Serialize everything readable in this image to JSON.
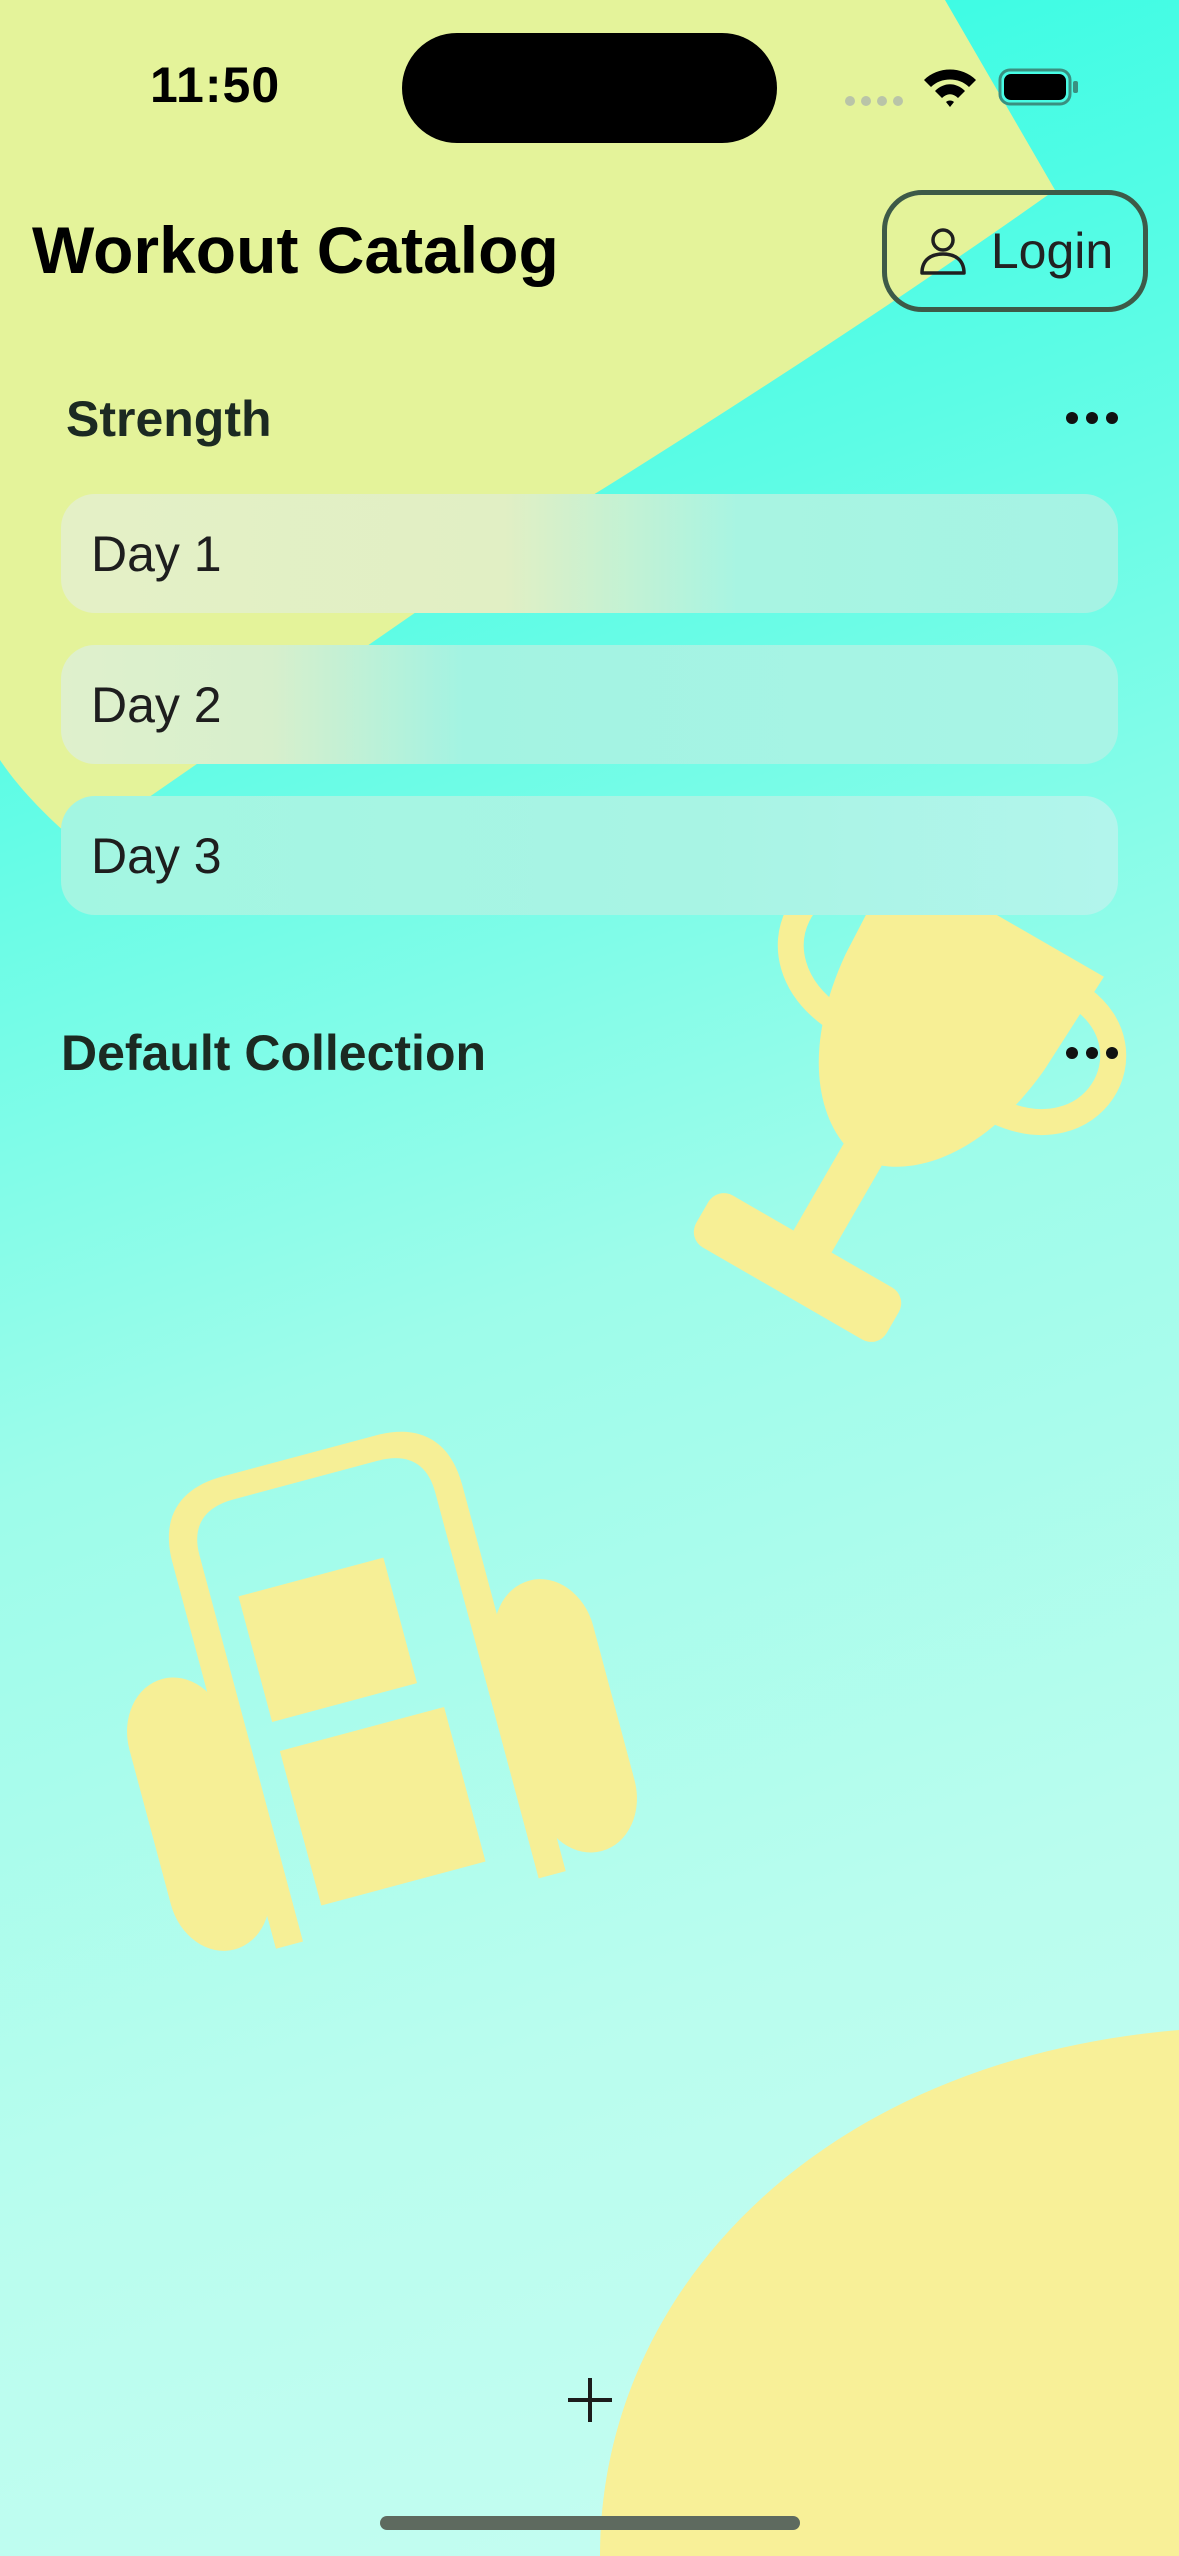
{
  "status_bar": {
    "time": "11:50"
  },
  "header": {
    "title": "Workout Catalog",
    "login_label": "Login"
  },
  "collections": [
    {
      "title": "Strength",
      "workouts": [
        "Day 1",
        "Day 2",
        "Day 3"
      ]
    },
    {
      "title": "Default Collection",
      "workouts": []
    }
  ],
  "icons": {
    "person": "person-icon",
    "more": "ellipsis-icon",
    "add": "plus-icon",
    "trophy": "trophy-icon",
    "bag": "gym-bag-icon",
    "wifi": "wifi-icon",
    "battery": "battery-icon"
  },
  "colors": {
    "background_top": "#26fce4",
    "background_bottom": "#c6fdf2",
    "shape_yellow": "#f8f098",
    "shape_lime": "#e4f39a",
    "login_border": "#3d5a48"
  }
}
